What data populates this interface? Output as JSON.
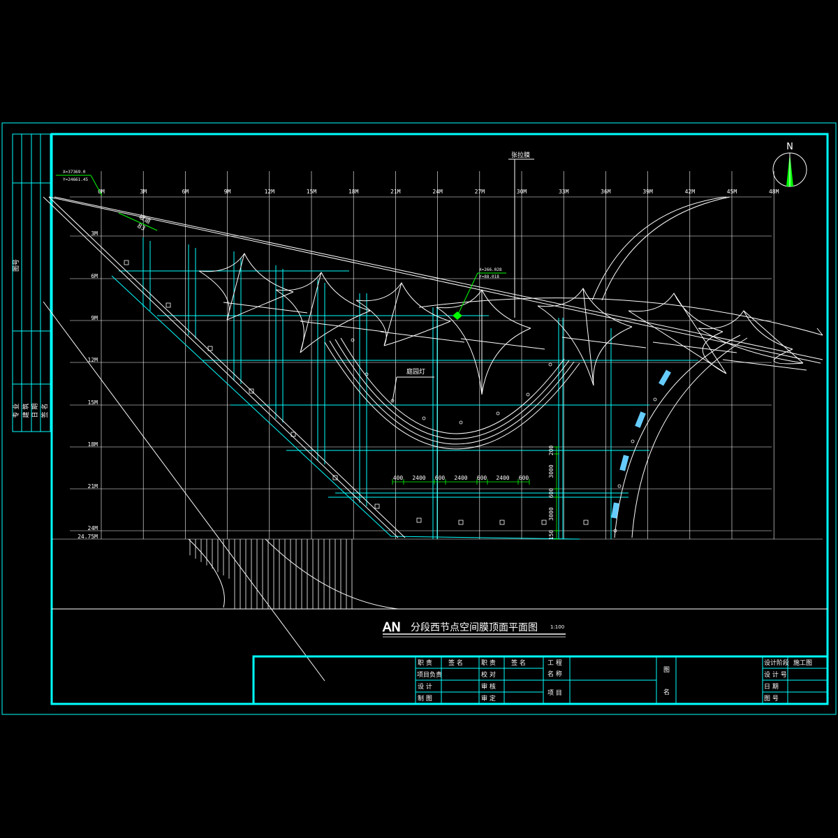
{
  "title": {
    "prefix": "AN",
    "main": "分段西节点空间膜顶面平面图",
    "scale": "1:100"
  },
  "north": {
    "label": "N"
  },
  "grid": {
    "x_labels": [
      "0M",
      "3M",
      "6M",
      "9M",
      "12M",
      "15M",
      "18M",
      "21M",
      "24M",
      "27M",
      "30M",
      "33M",
      "36M",
      "39M",
      "42M",
      "45M",
      "48M"
    ],
    "y_labels": [
      "3M",
      "6M",
      "9M",
      "12M",
      "15M",
      "18M",
      "21M",
      "24M",
      "24.75M"
    ]
  },
  "annotations": {
    "membrane": "张拉膜",
    "courtyard_light": "庭园灯",
    "coord_top_x": "X=37369.0",
    "coord_top_y": "Y=24661.45",
    "coord_mid_x": "X=266.028",
    "coord_mid_y": "Y=88.018",
    "slope": "坡道",
    "slope_val": "83"
  },
  "dimensions": {
    "h": [
      "400",
      "2400",
      "600",
      "2400",
      "600",
      "2400",
      "600"
    ],
    "v": [
      "200",
      "3000",
      "600",
      "3000",
      "150"
    ]
  },
  "title_block": {
    "cells": {
      "r1c1": "职 责",
      "r1c2": "签 名",
      "r1c3": "职 责",
      "r1c4": "签 名",
      "r2c1": "项目负责",
      "r2c3": "校 对",
      "r3c1": "设 计",
      "r3c3": "审 核",
      "r4c1": "制 图",
      "r4c3": "审 定",
      "proj_a": "工 程",
      "proj_b": "名 称",
      "proj_c": "项 目",
      "drawing_name_a": "图",
      "drawing_name_b": "名",
      "stage_label": "设计阶段",
      "stage_val": "施工图",
      "num_label": "设 计 号",
      "date_label": "日 期",
      "sheet_label": "图 号"
    }
  },
  "left_strip": {
    "top_label": "图号",
    "bottom_labels": [
      "专 业",
      "建 筑",
      "日 期",
      "签 名"
    ]
  }
}
